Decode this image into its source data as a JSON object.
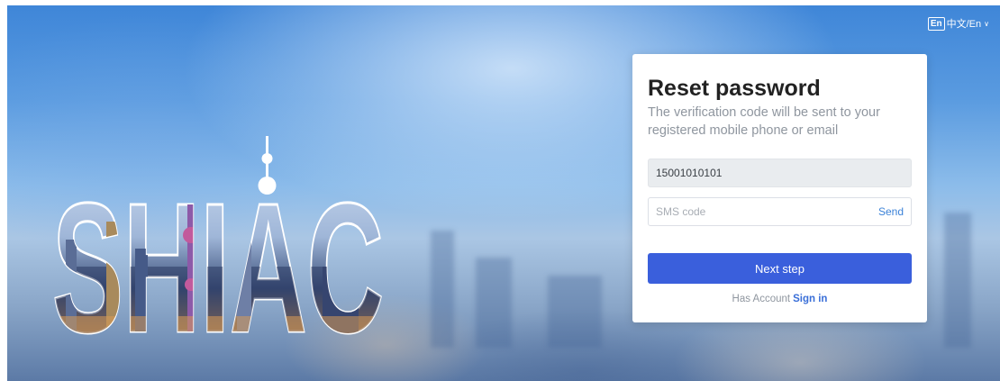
{
  "language_switch": {
    "badge": "En",
    "label": "中文/En",
    "chevron": "chevron-down-icon"
  },
  "logo": {
    "text": "SHIAC"
  },
  "reset_card": {
    "title": "Reset password",
    "subtitle": "The verification code will be sent to your registered mobile phone or email",
    "phone_value": "15001010101",
    "sms_placeholder": "SMS code",
    "send_label": "Send",
    "next_label": "Next step",
    "has_account_text": "Has Account",
    "sign_in_label": "Sign in"
  },
  "colors": {
    "primary_button": "#3a5fdc",
    "link": "#3a6fd8",
    "subtitle": "#8f969f"
  }
}
